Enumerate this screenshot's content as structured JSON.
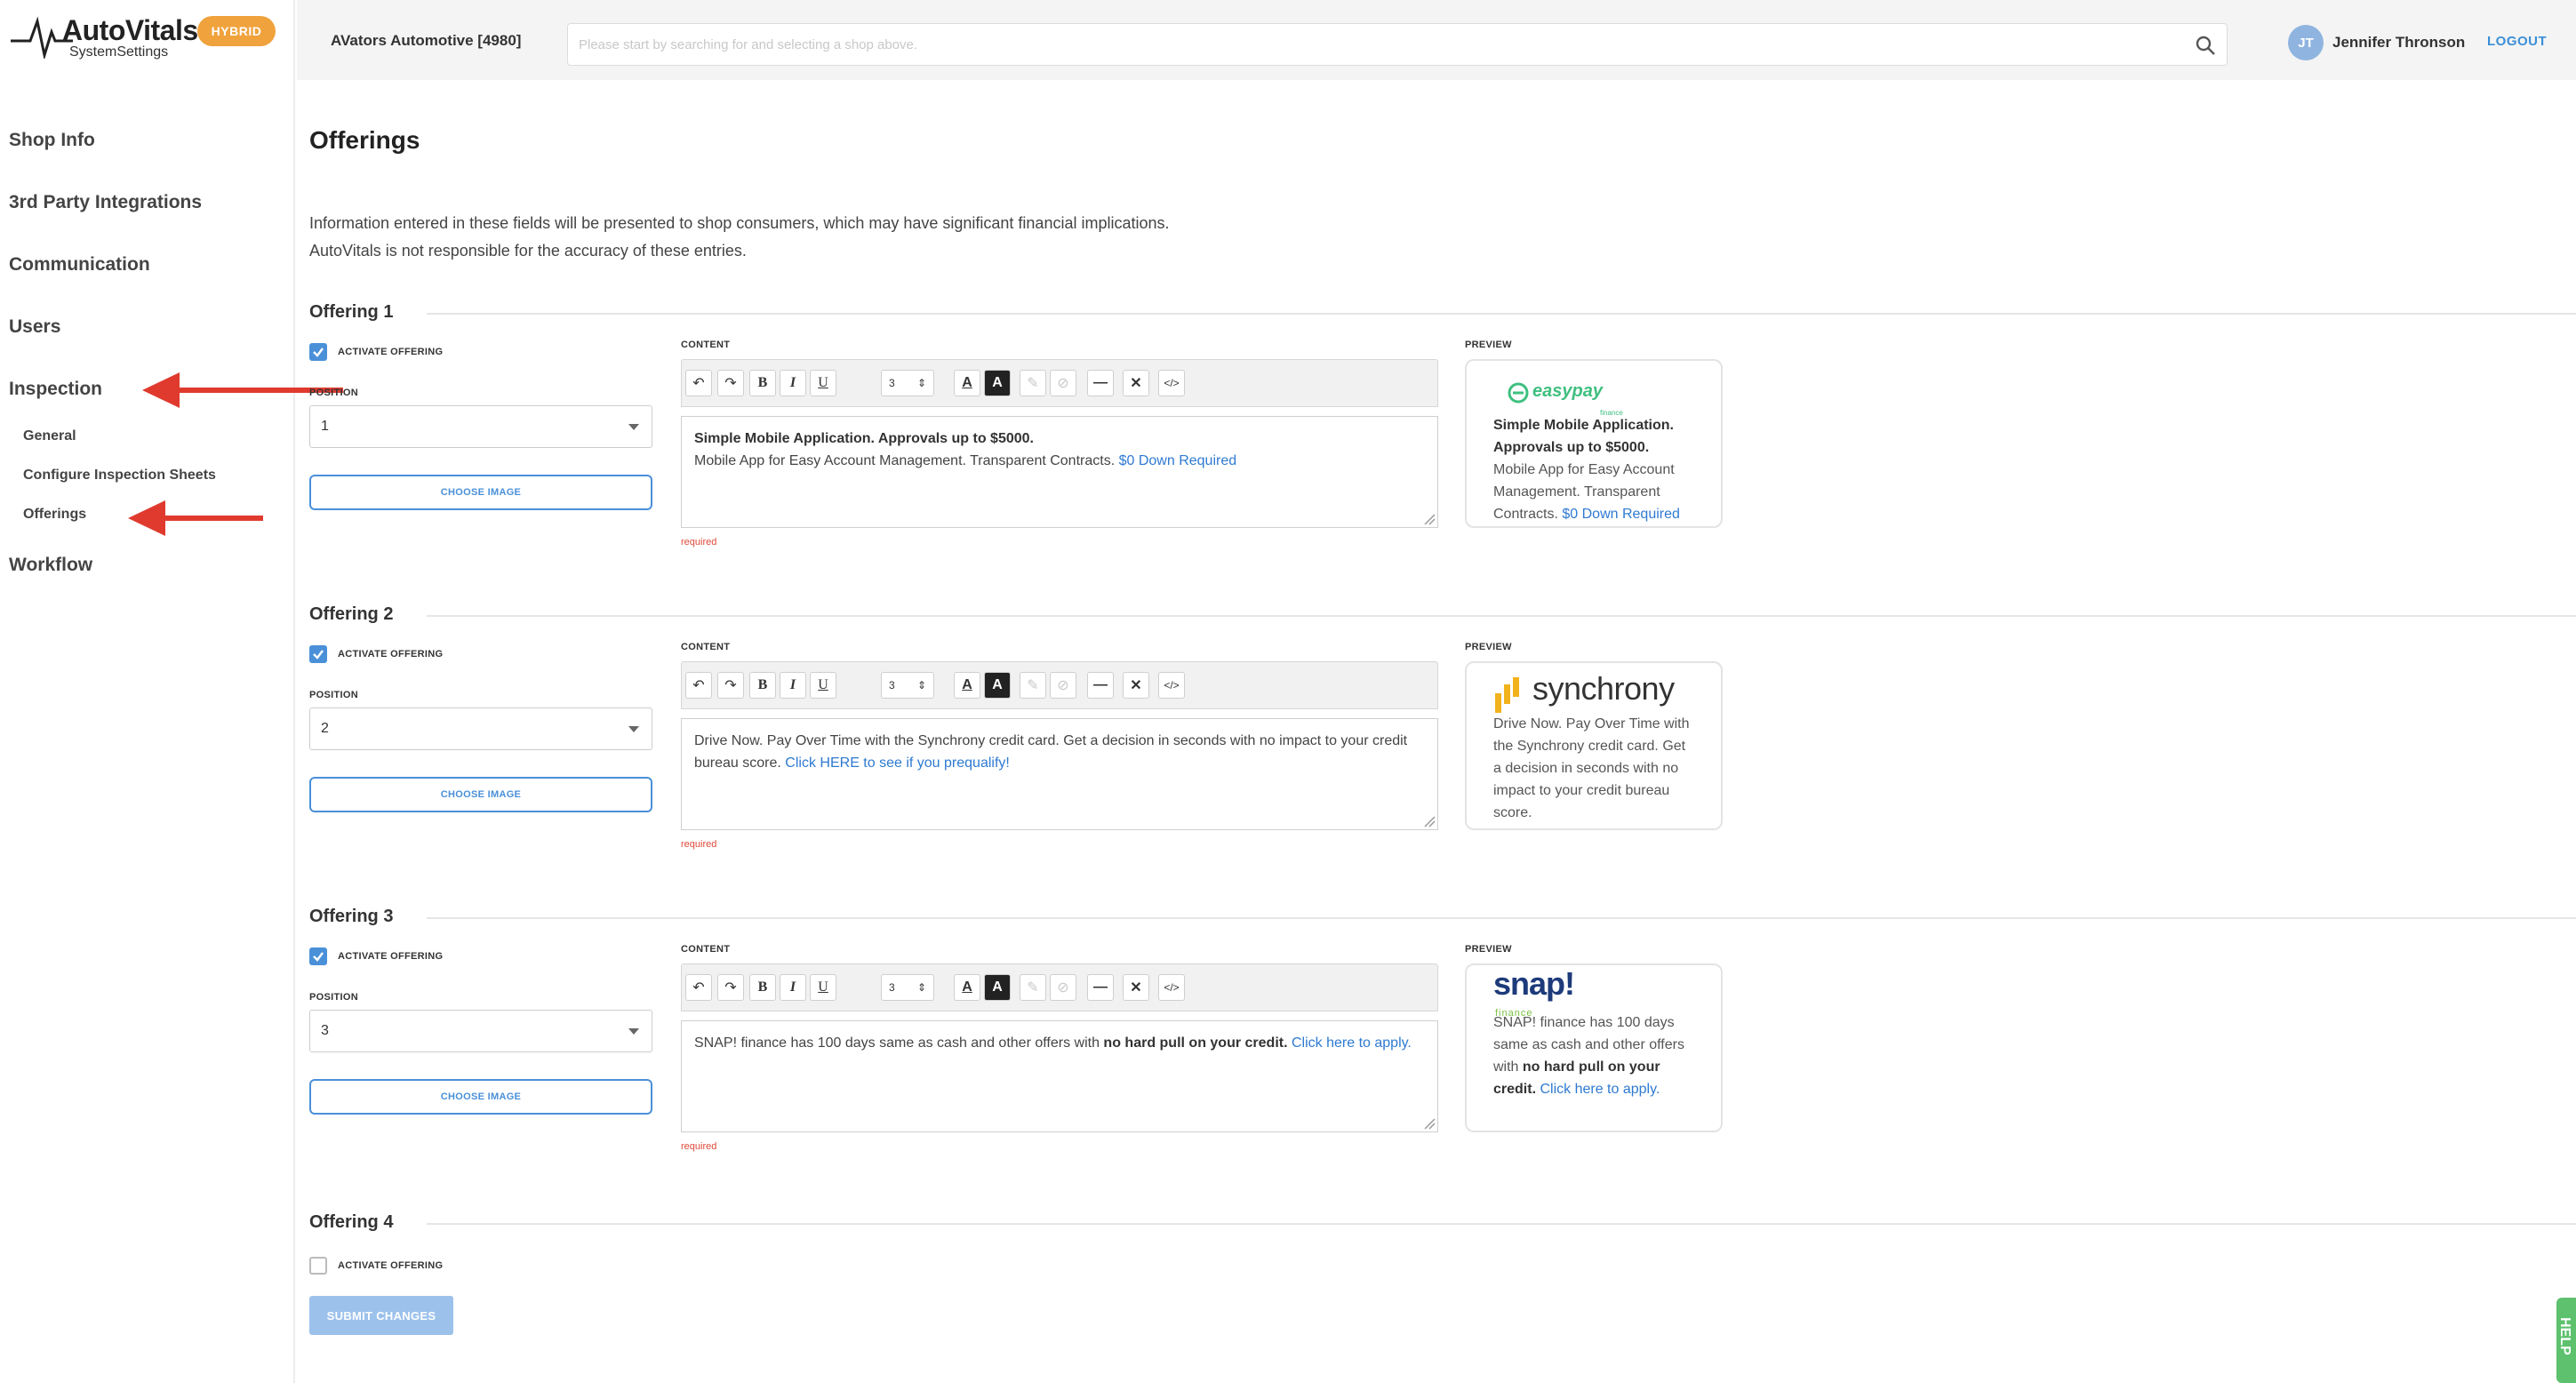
{
  "brand": {
    "name": "AutoVitals",
    "subtitle": "SystemSettings",
    "badge": "HYBRID"
  },
  "sidebar": {
    "items": [
      {
        "label": "Shop Info"
      },
      {
        "label": "3rd Party Integrations"
      },
      {
        "label": "Communication"
      },
      {
        "label": "Users"
      },
      {
        "label": "Inspection"
      },
      {
        "label": "General"
      },
      {
        "label": "Configure Inspection Sheets"
      },
      {
        "label": "Offerings"
      },
      {
        "label": "Workflow"
      }
    ]
  },
  "topbar": {
    "shop": "AVators Automotive [4980]",
    "search_placeholder": "Please start by searching for and selecting a shop above.",
    "user_initials": "JT",
    "user_name": "Jennifer Thronson",
    "logout": "LOGOUT"
  },
  "page": {
    "title": "Offerings",
    "disclaimer_1": "Information entered in these fields will be presented to shop consumers, which may have significant financial implications.",
    "disclaimer_2": "AutoVitals is not responsible for the accuracy of these entries.",
    "labels": {
      "activate": "ACTIVATE OFFERING",
      "position": "POSITION",
      "content": "CONTENT",
      "preview": "PREVIEW",
      "choose_image": "CHOOSE IMAGE",
      "required": "required",
      "font_size": "3"
    },
    "submit": "SUBMIT CHANGES",
    "help": "HELP"
  },
  "offerings": [
    {
      "title": "Offering 1",
      "active": true,
      "position": "1",
      "logo": "easypay",
      "logo_sub": "finance",
      "bold": "Simple Mobile Application. Approvals up to $5000.",
      "text": "Mobile App for Easy Account Management. Transparent Contracts.",
      "link": "$0 Down Required"
    },
    {
      "title": "Offering 2",
      "active": true,
      "position": "2",
      "logo": "synchrony",
      "text": "Drive Now. Pay Over Time with the Synchrony credit card. Get a decision in seconds with no impact to your credit bureau score.",
      "link": "Click HERE to see if you prequalify!",
      "preview_text": "Drive Now. Pay Over Time with the Synchrony credit card. Get a decision in seconds with no impact to your credit bureau score."
    },
    {
      "title": "Offering 3",
      "active": true,
      "position": "3",
      "logo": "snap!",
      "logo_sub": "finance",
      "text": "SNAP! finance has 100 days same as cash and other offers with",
      "bold": "no hard pull on your credit.",
      "link": "Click here to apply."
    },
    {
      "title": "Offering 4",
      "active": false
    }
  ],
  "colors": {
    "accent": "#4a90d9",
    "link": "#2e7ad1",
    "badge": "#f0a23c",
    "arrow": "#e03a2f",
    "required": "#e04a3a",
    "help": "#5dc16e"
  }
}
